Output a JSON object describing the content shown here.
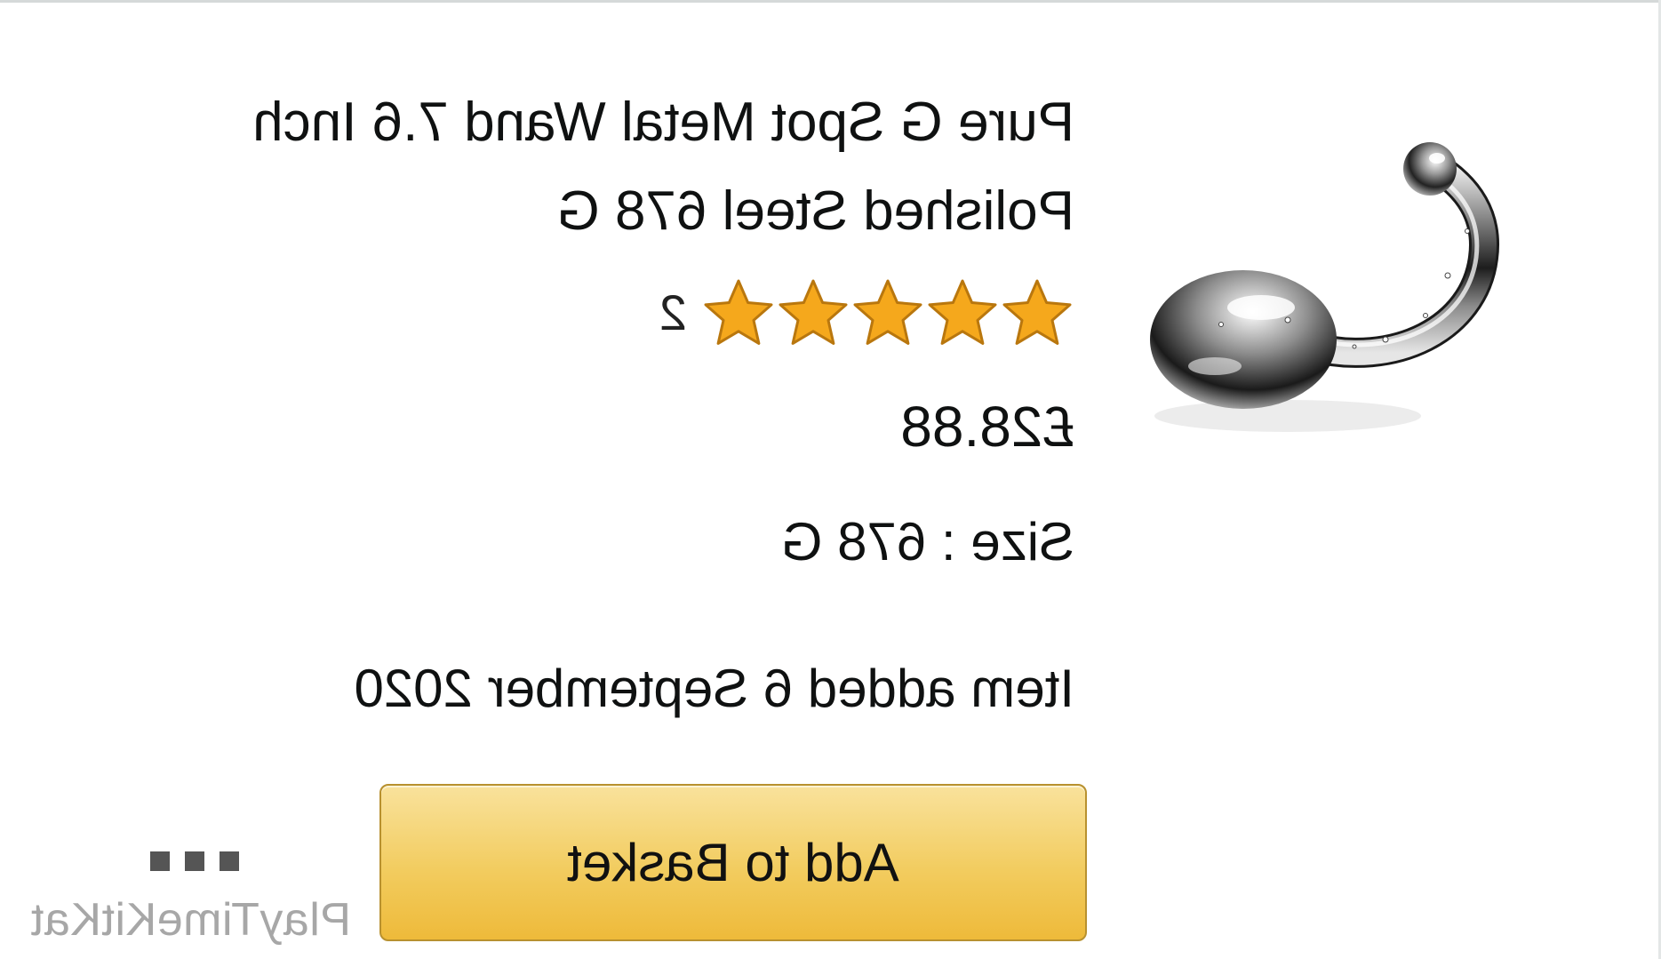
{
  "product": {
    "title": "Pure G Spot Metal Wand 7.6 Inch Polished Steel 678 G",
    "rating": {
      "stars_filled": 5,
      "stars_total": 5,
      "review_count": "2",
      "star_color": "#f5a81c"
    },
    "price": "£28.88",
    "size_line": "Size : 678 G",
    "added_line": "Item added 6 September 2020",
    "image": {
      "icon": "metal-wand-product-image"
    }
  },
  "actions": {
    "add_to_basket_label": "Add to Basket",
    "button_color": "#f2cc5f",
    "more_icon": "more-options-icon"
  },
  "watermark": {
    "text": "PlayTimeKitKat"
  }
}
